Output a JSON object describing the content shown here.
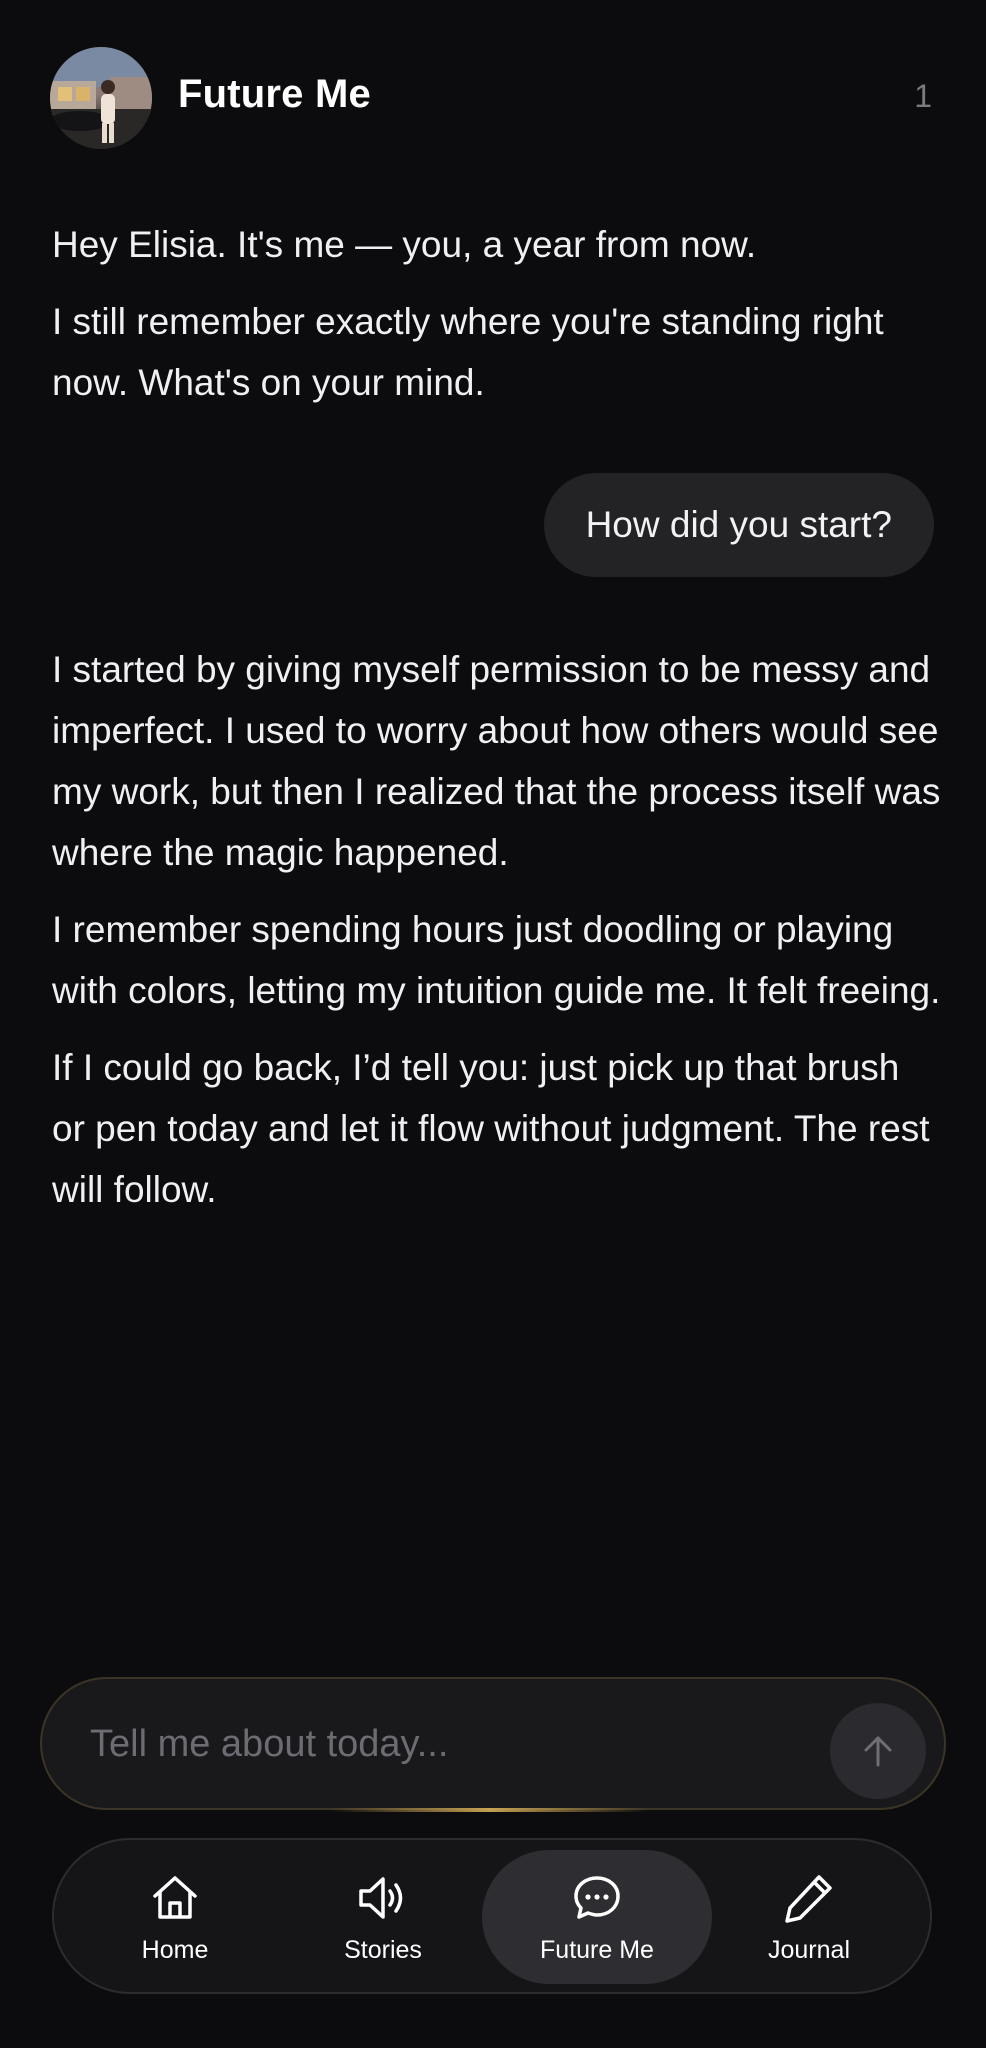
{
  "header": {
    "title": "Future Me",
    "count": "1",
    "avatar_icon": "profile-photo"
  },
  "messages": [
    {
      "role": "assistant",
      "paragraphs": [
        "Hey Elisia. It's me — you, a year from now.",
        "I still remember exactly where you're standing right now. What's on your mind."
      ]
    },
    {
      "role": "user",
      "text": "How did you start?"
    },
    {
      "role": "assistant",
      "paragraphs": [
        "I started by giving myself permission to be messy and imperfect. I used to worry about how others would see my work, but then I realized that the process itself was where the magic happened.",
        "I remember spending hours just doodling or playing with colors, letting my intuition guide me. It felt freeing.",
        "If I could go back, I’d tell you: just pick up that brush or pen today and let it flow without judgment. The rest will follow."
      ]
    }
  ],
  "input": {
    "placeholder": "Tell me about today...",
    "value": "",
    "send_icon": "arrow-up-icon"
  },
  "tabs": [
    {
      "label": "Home",
      "icon": "home-icon",
      "active": false
    },
    {
      "label": "Stories",
      "icon": "speaker-icon",
      "active": false
    },
    {
      "label": "Future Me",
      "icon": "chat-bubble-icon",
      "active": true
    },
    {
      "label": "Journal",
      "icon": "pencil-icon",
      "active": false
    }
  ],
  "colors": {
    "background": "#0c0c0e",
    "bubble": "#232326",
    "accent_gold": "#d6af58",
    "muted_text": "#6c6c72"
  }
}
